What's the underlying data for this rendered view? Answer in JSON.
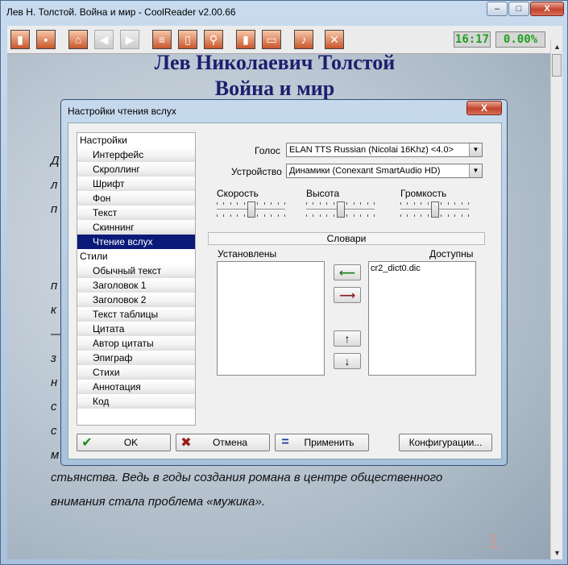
{
  "window": {
    "title": "Лев Н. Толстой. Война и мир - CoolReader v2.00.66",
    "minimize": "–",
    "maximize": "□",
    "close": "X"
  },
  "toolbar": {
    "time": "16:17",
    "progress": "0.00%"
  },
  "book": {
    "heading1": "Лев Николаевич Толстой",
    "heading2": "Война и мир",
    "line1": "стьянства. Ведь в годы создания романа в центре общественного",
    "line2": "внимания стала проблема «мужика».",
    "page_number": "1",
    "fragments": [
      "Д",
      "л",
      "п",
      "п",
      "к",
      "—",
      "з",
      "н",
      "с",
      "с",
      "м"
    ]
  },
  "dialog": {
    "title": "Настройки чтения вслух",
    "close_label": "X",
    "tree": [
      {
        "label": "Настройки",
        "level": 0
      },
      {
        "label": "Интерфейс",
        "level": 1
      },
      {
        "label": "Скроллинг",
        "level": 1
      },
      {
        "label": "Шрифт",
        "level": 1
      },
      {
        "label": "Фон",
        "level": 1
      },
      {
        "label": "Текст",
        "level": 1
      },
      {
        "label": "Скиннинг",
        "level": 1
      },
      {
        "label": "Чтение вслух",
        "level": 1,
        "selected": true
      },
      {
        "label": "Стили",
        "level": 0
      },
      {
        "label": "Обычный текст",
        "level": 1
      },
      {
        "label": "Заголовок 1",
        "level": 1
      },
      {
        "label": "Заголовок 2",
        "level": 1
      },
      {
        "label": "Текст таблицы",
        "level": 1
      },
      {
        "label": "Цитата",
        "level": 1
      },
      {
        "label": "Автор цитаты",
        "level": 1
      },
      {
        "label": "Эпиграф",
        "level": 1
      },
      {
        "label": "Стихи",
        "level": 1
      },
      {
        "label": "Аннотация",
        "level": 1
      },
      {
        "label": "Код",
        "level": 1
      }
    ],
    "voice_label": "Голос",
    "voice_value": "ELAN TTS Russian (Nicolai 16Khz)  <4.0>",
    "device_label": "Устройство",
    "device_value": "Динамики (Conexant SmartAudio HD)",
    "speed_label": "Скорость",
    "pitch_label": "Высота",
    "volume_label": "Громкость",
    "speed_level": 0.5,
    "pitch_level": 0.5,
    "volume_level": 0.5,
    "dict_section": "Словари",
    "installed_label": "Установлены",
    "available_label": "Доступны",
    "available_items": [
      "cr2_dict0.dic"
    ],
    "ok_label": "OK",
    "cancel_label": "Отмена",
    "apply_label": "Применить",
    "config_label": "Конфигурации..."
  },
  "colors": {
    "selection": "#0a1a78",
    "heading": "#1c1f6e",
    "ok_check": "#1c8c1c",
    "cancel_x": "#9a1a1a",
    "apply_eq": "#1a3c9a"
  }
}
